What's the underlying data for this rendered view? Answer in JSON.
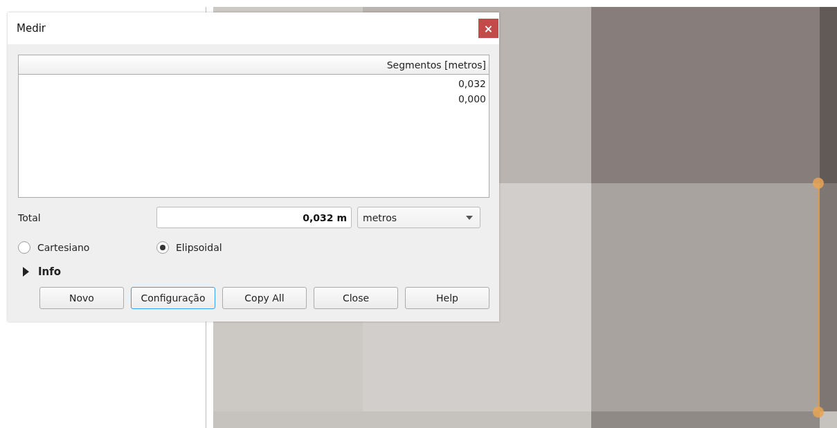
{
  "dialog": {
    "title": "Medir",
    "close_label": "×",
    "table": {
      "columns": [
        "Segmentos [metros]"
      ],
      "rows": [
        [
          "0,032"
        ],
        [
          "0,000"
        ]
      ]
    },
    "total": {
      "label": "Total",
      "value": "0,032 m",
      "unit": "metros"
    },
    "modes": [
      {
        "label": "Cartesiano",
        "selected": false
      },
      {
        "label": "Elipsoidal",
        "selected": true
      }
    ],
    "info": {
      "label": "Info",
      "expanded": false
    },
    "buttons": [
      {
        "label": "Novo",
        "focused": false
      },
      {
        "label": "Configuração",
        "focused": true
      },
      {
        "label": "Copy All",
        "focused": false
      },
      {
        "label": "Close",
        "focused": false
      },
      {
        "label": "Help",
        "focused": false
      }
    ]
  }
}
